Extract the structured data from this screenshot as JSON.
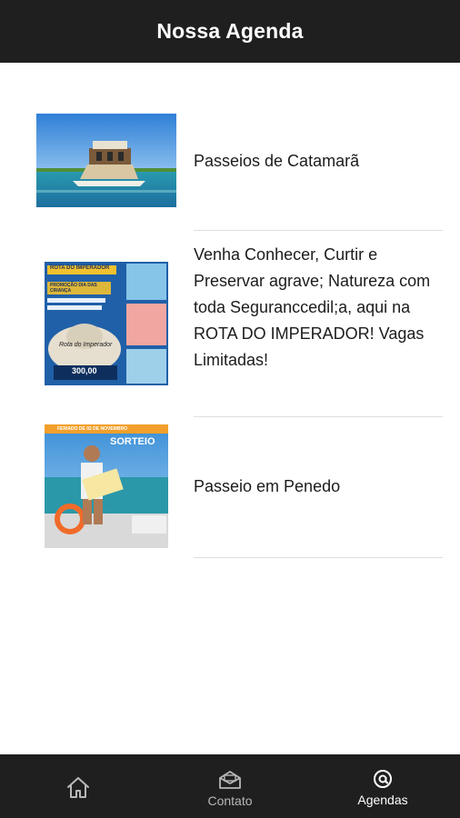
{
  "header": {
    "title": "Nossa Agenda"
  },
  "events": [
    {
      "title": "Passeios de Catamarã",
      "image": "catamaran-photo"
    },
    {
      "title": "Venha Conhecer, Curtir e Preservar agrave; Natureza com toda Seguranccedil;a, aqui na ROTA DO IMPERADOR! Vagas Limitadas!",
      "image": "rota-do-imperador-flyer",
      "image_text": {
        "top": "ROTA DO IMPERADOR",
        "promo": "PROMOÇÃO DIA DAS CRIANÇA",
        "price": "300,00",
        "hat": "Rota do Imperador"
      }
    },
    {
      "title": "Passeio em Penedo",
      "image": "sorteio-flyer",
      "image_text": {
        "top": "FERIADO DE 02 DE NOVEMBRO",
        "headline": "SORTEIO"
      }
    }
  ],
  "tabbar": {
    "tabs": [
      {
        "label": "",
        "icon": "home-icon",
        "active": false
      },
      {
        "label": "Contato",
        "icon": "envelope-icon",
        "active": false
      },
      {
        "label": "Agendas",
        "icon": "at-sign-icon",
        "active": true
      }
    ],
    "active_color": "#ffffff",
    "inactive_color": "#b8b8b8"
  }
}
